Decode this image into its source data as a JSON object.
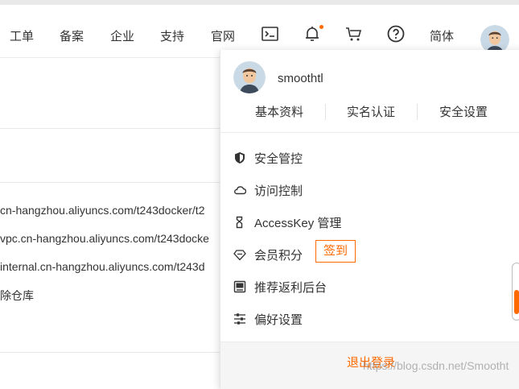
{
  "topbar": {
    "nav": [
      "工单",
      "备案",
      "企业",
      "支持",
      "官网"
    ],
    "language": "简体",
    "icons": [
      "terminal-icon",
      "bell-icon",
      "cart-icon",
      "help-icon"
    ],
    "notification_dot_color": "#ff6a00"
  },
  "background": {
    "lines": [
      "cn-hangzhou.aliyuncs.com/t243docker/t2",
      "vpc.cn-hangzhou.aliyuncs.com/t243docke",
      "internal.cn-hangzhou.aliyuncs.com/t243d",
      "除仓库"
    ]
  },
  "dropdown": {
    "username": "smoothtl",
    "links": [
      "基本资料",
      "实名认证",
      "安全设置"
    ],
    "menu": [
      {
        "icon": "shield-icon",
        "label": "安全管控"
      },
      {
        "icon": "cloud-icon",
        "label": "访问控制"
      },
      {
        "icon": "key-icon",
        "label": "AccessKey 管理"
      },
      {
        "icon": "diamond-icon",
        "label": "会员积分"
      },
      {
        "icon": "dashboard-icon",
        "label": "推荐返利后台"
      },
      {
        "icon": "sliders-icon",
        "label": "偏好设置"
      }
    ],
    "checkin_label": "签到",
    "logout_label": "退出登录"
  },
  "watermark": "https://blog.csdn.net/Smootht",
  "colors": {
    "accent": "#ff6a00"
  }
}
